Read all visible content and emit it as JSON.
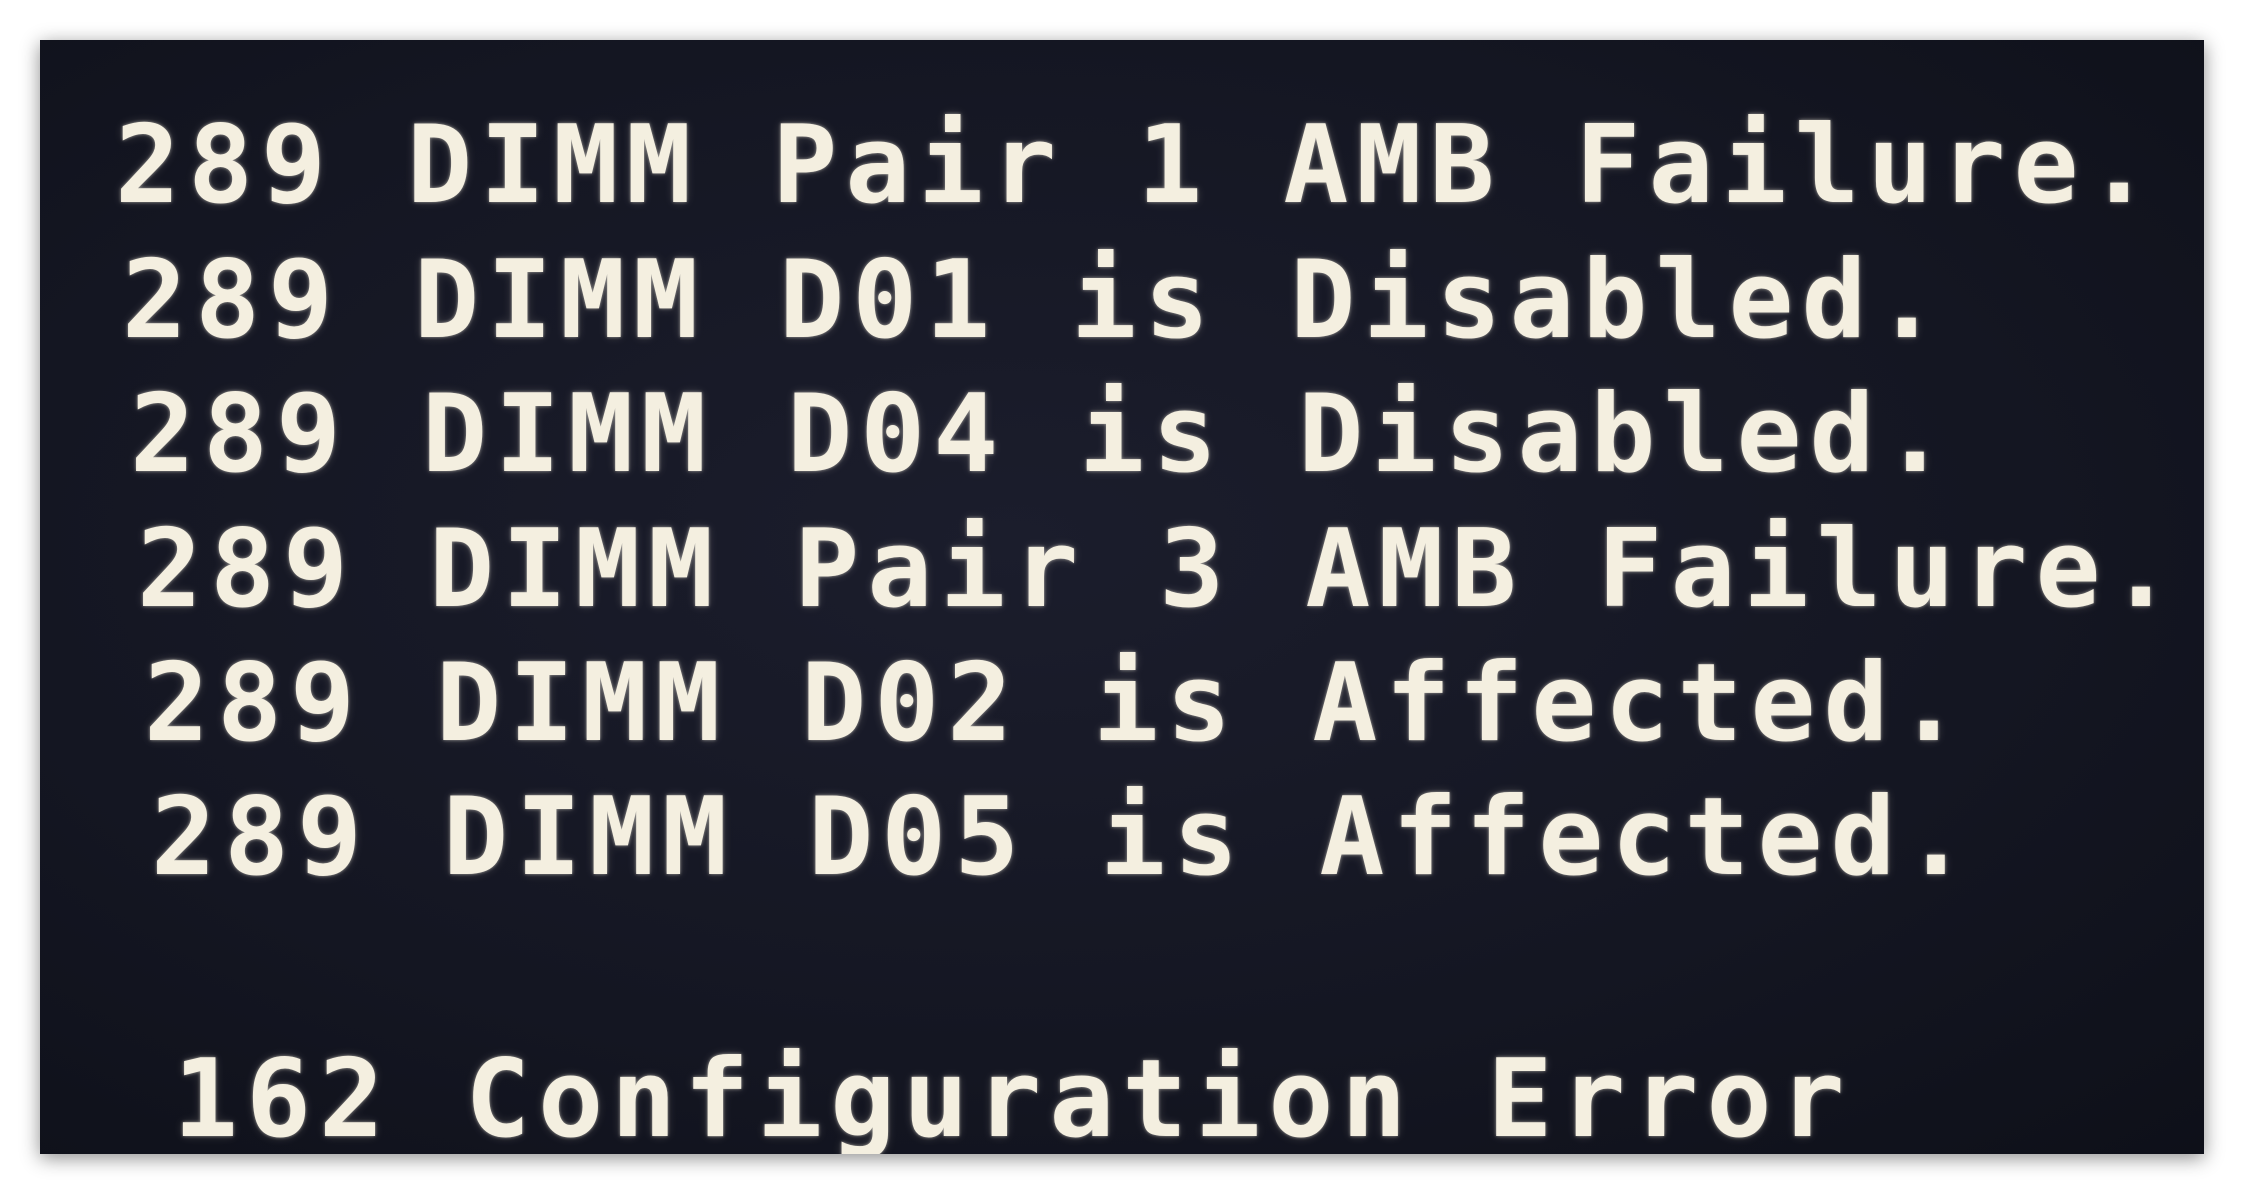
{
  "screen": {
    "background_color": "#141622",
    "text_color": "#f4efe0",
    "messages": [
      "289 DIMM Pair 1 AMB Failure.",
      "289 DIMM D01 is Disabled.",
      "289 DIMM D04 is Disabled.",
      "289 DIMM Pair 3 AMB Failure.",
      "289 DIMM D02 is Affected.",
      "289 DIMM D05 is Affected."
    ],
    "error": "162 Configuration Error"
  }
}
